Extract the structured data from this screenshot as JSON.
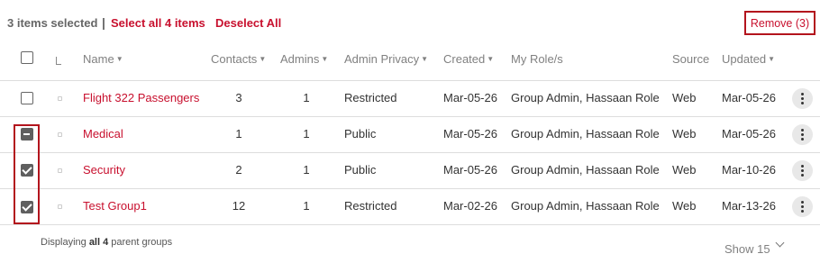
{
  "selection": {
    "count_label": "3 items selected",
    "separator": "|",
    "select_all_label": "Select all 4 items",
    "deselect_all_label": "Deselect All",
    "remove_label": "Remove (3)"
  },
  "columns": {
    "name": "Name",
    "contacts": "Contacts",
    "admins": "Admins",
    "admin_privacy": "Admin Privacy",
    "created": "Created",
    "my_roles": "My Role/s",
    "source": "Source",
    "updated": "Updated",
    "sort_icon": "caret-down-icon"
  },
  "rows": [
    {
      "name": "Flight 322 Passengers",
      "contacts": "3",
      "admins": "1",
      "admin_privacy": "Restricted",
      "created": "Mar-05-26",
      "my_roles": "Group Admin, Hassaan Role",
      "source": "Web",
      "updated": "Mar-05-26",
      "checkbox_state": "unchecked"
    },
    {
      "name": "Medical",
      "contacts": "1",
      "admins": "1",
      "admin_privacy": "Public",
      "created": "Mar-05-26",
      "my_roles": "Group Admin, Hassaan Role",
      "source": "Web",
      "updated": "Mar-05-26",
      "checkbox_state": "indeterminate"
    },
    {
      "name": "Security",
      "contacts": "2",
      "admins": "1",
      "admin_privacy": "Public",
      "created": "Mar-05-26",
      "my_roles": "Group Admin, Hassaan Role",
      "source": "Web",
      "updated": "Mar-10-26",
      "checkbox_state": "checked"
    },
    {
      "name": "Test Group1",
      "contacts": "12",
      "admins": "1",
      "admin_privacy": "Restricted",
      "created": "Mar-02-26",
      "my_roles": "Group Admin, Hassaan Role",
      "source": "Web",
      "updated": "Mar-13-26",
      "checkbox_state": "checked"
    }
  ],
  "footer": {
    "prefix": "Displaying",
    "count": "all 4",
    "suffix": "parent groups",
    "page_size_label": "Show 15"
  },
  "colors": {
    "accent": "#c8102e",
    "highlight_border": "#b3141d",
    "checkbox_fill": "#5f5f5f",
    "muted_text": "#808080"
  }
}
